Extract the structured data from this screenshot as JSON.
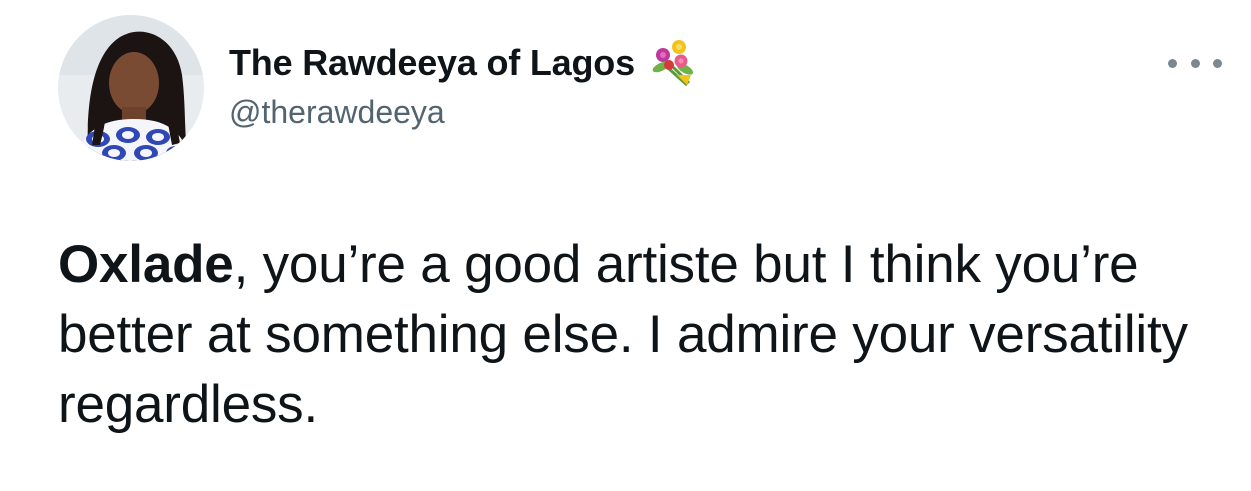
{
  "author": {
    "display_name": "The Rawdeeya of Lagos",
    "display_name_emoji": "bouquet-icon",
    "handle": "@therawdeeya"
  },
  "actions": {
    "more_icon": "more-horizontal-icon"
  },
  "tweet": {
    "bold_lead": "Oxlade",
    "text": ", you’re a good artiste but I think you’re better at something else. I admire your versatility regardless."
  },
  "colors": {
    "text_primary": "#0f1419",
    "text_secondary": "#536471",
    "background": "#ffffff"
  }
}
